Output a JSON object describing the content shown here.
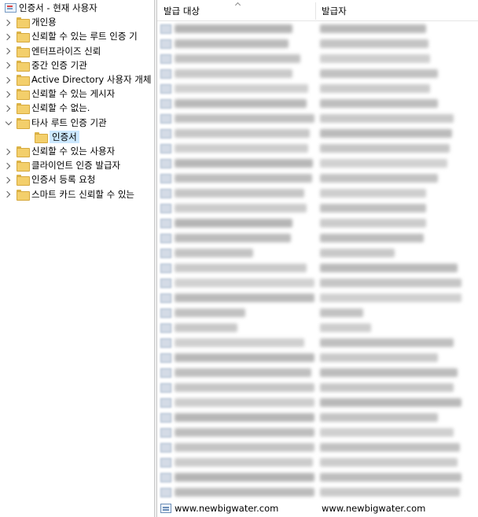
{
  "tree": {
    "root": {
      "label": "인증서 - 현재 사용자",
      "icon": "certificate-store-icon"
    },
    "items": [
      {
        "label": "개인용",
        "expanded": false
      },
      {
        "label": "신뢰할 수 있는 루트 인증 기",
        "expanded": false
      },
      {
        "label": "엔터프라이즈 신뢰",
        "expanded": false
      },
      {
        "label": "중간 인증 기관",
        "expanded": false
      },
      {
        "label": "Active Directory 사용자 개체",
        "expanded": false
      },
      {
        "label": "신뢰할 수 있는 게시자",
        "expanded": false
      },
      {
        "label": "신뢰할 수 없는.",
        "expanded": false
      },
      {
        "label": "타사 루트 인증 기관",
        "expanded": true
      },
      {
        "label": "인증서",
        "child": true,
        "selected": true
      },
      {
        "label": "신뢰할 수 있는 사용자",
        "expanded": false
      },
      {
        "label": "클라이언트 인증 발급자",
        "expanded": false
      },
      {
        "label": "인증서 등록 요청",
        "expanded": false
      },
      {
        "label": "스마트 카드 신뢰할 수 있는",
        "expanded": false
      }
    ]
  },
  "list": {
    "columns": [
      "발급 대상",
      "발급자"
    ],
    "sorted_column": "발급 대상",
    "last_row": {
      "issued_to": "www.newbigwater.com",
      "issued_by": "www.newbigwater.com"
    }
  },
  "colors": {
    "selection": "#cce8ff",
    "folder": "#f3cf6b",
    "blurred_text": "#c9c9c9"
  }
}
